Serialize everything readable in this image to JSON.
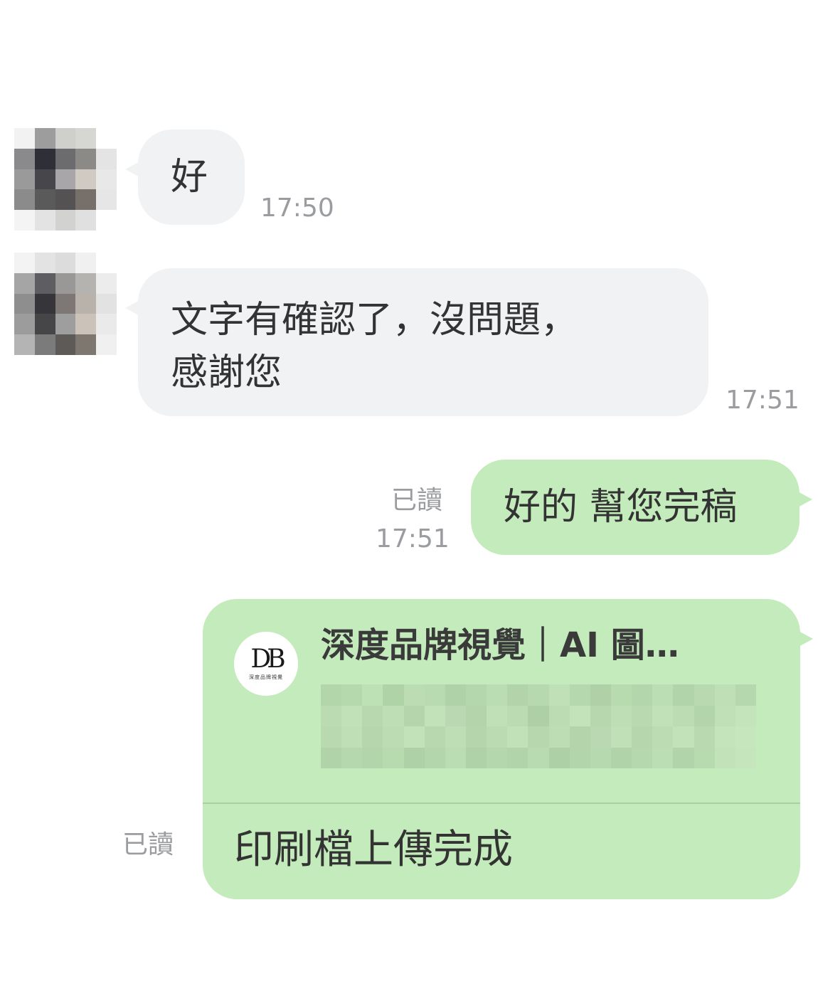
{
  "messages": [
    {
      "text": "好",
      "time": "17:50"
    },
    {
      "text": "文字有確認了，沒問題，\n感謝您",
      "time": "17:51"
    },
    {
      "text": "好的 幫您完稿",
      "time": "17:51",
      "read": "已讀"
    }
  ],
  "link_card": {
    "logo_mono": "DB",
    "logo_sub": "深度品牌視覺",
    "title": "深度品牌視覺｜AI 圖…",
    "caption": "印刷檔上傳完成",
    "read": "已讀"
  },
  "colors": {
    "incoming_bubble": "#f1f2f4",
    "outgoing_bubble": "#c4ebbb",
    "timestamp": "#9a9ca0"
  },
  "icons": {
    "avatar": "pixelated-avatar",
    "card_logo": "brand-logo"
  }
}
